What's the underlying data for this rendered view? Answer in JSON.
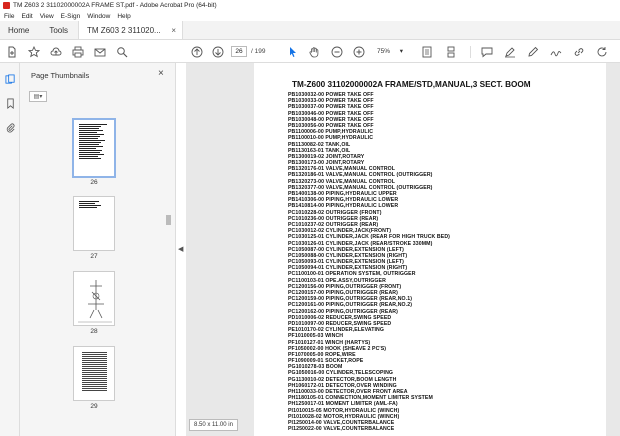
{
  "window": {
    "title": "TM Z603 2 31102000002A FRAME ST.pdf - Adobe Acrobat Pro (64-bit)"
  },
  "menu": [
    "File",
    "Edit",
    "View",
    "E-Sign",
    "Window",
    "Help"
  ],
  "tabs": {
    "home": "Home",
    "tools": "Tools",
    "document": "TM Z603 2 311020...",
    "close": "×"
  },
  "toolbar": {
    "current_page": "26",
    "total_pages": "/ 199",
    "zoom": "75%"
  },
  "thumbnails_panel": {
    "title": "Page Thumbnails",
    "close": "×",
    "options_icon": "▤▾",
    "pages": [
      "26",
      "27",
      "28",
      "29"
    ],
    "selected_page": "26"
  },
  "document": {
    "title": "TM-Z600 31102000002A FRAME/STD,MANUAL,3 SECT. BOOM",
    "entries": [
      "PB1030032-00 POWER TAKE OFF",
      "PB1030033-00 POWER TAKE OFF",
      "PB1030037-00 POWER TAKE OFF",
      "PB1030046-00 POWER TAKE OFF",
      "PB1030048-00 POWER TAKE OFF",
      "PB1030056-00 POWER TAKE OFF",
      "PB1100006-00 PUMP,HYDRAULIC",
      "PB1100010-00 PUMP,HYDRAULIC",
      "PB1130082-02 TANK,OIL",
      "PB1130163-01 TANK,OIL",
      "PB1300019-02 JOINT,ROTARY",
      "PB1300173-00 JOINT,ROTARY",
      "PB1320176-01 VALVE,MANUAL CONTROL",
      "PB1320186-01 VALVE,MANUAL CONTROL (OUTRIGGER)",
      "PB1320273-00 VALVE,MANUAL CONTROL",
      "PB1320377-00 VALVE,MANUAL CONTROL (OUTRIGGER)",
      "PB1400138-00 PIPING,HYDRAULIC UPPER",
      "PB1410306-00 PIPING,HYDRAULIC LOWER",
      "PB1410814-00 PIPING,HYDRAULIC LOWER",
      "PC1010228-02 OUTRIGGER (FRONT)",
      "PC1010236-00 OUTRIGGER (REAR)",
      "PC1010237-02 OUTRIGGER (REAR)",
      "PC1030012-02 CYLINDER,JACK(FRONT)",
      "PC1030125-01 CYLINDER,JACK (REAR FOR HIGH TRUCK BED)",
      "PC1030126-01 CYLINDER,JACK (REAR/STROKE 330MM)",
      "PC1050087-00 CYLINDER,EXTENSION (LEFT)",
      "PC1050088-00 CYLINDER,EXTENSION (RIGHT)",
      "PC1050093-01 CYLINDER,EXTENSION (LEFT)",
      "PC1050094-01 CYLINDER,EXTENSION (RIGHT)",
      "PC1100100-01 OPERATION SYSTEM, OUTRIGGER",
      "PC1100103-01 OPE.ASSY,OUTRIGGER",
      "PC1200156-00 PIPING,OUTRIGGER (FRONT)",
      "PC1200157-00 PIPING,OUTRIGGER (REAR)",
      "PC1200159-00 PIPING,OUTRIGGER (REAR,NO.1)",
      "PC1200161-00 PIPING,OUTRIGGER (REAR,NO.2)",
      "PC1200162-00 PIPING,OUTRIGGER (REAR)",
      "PD1010006-02 REDUCER,SWING SPEED",
      "PD1010097-00 REDUCER,SWING SPEED",
      "PE1010170-02 CYLINDER,ELEVATING",
      "PF1010005-03 WINCH",
      "PF1010127-01 WINCH (HARTYS)",
      "PF1050002-00 HOOK (SHEAVE 2 PC'S)",
      "PF1070005-00 ROPE,WIRE",
      "PF1090009-01 SOCKET,ROPE",
      "PG1010278-03 BOOM",
      "PG1050016-00 CYLINDER,TELESCOPING",
      "PG1130010-02 DETECTOR,BOOM LENGTH",
      "PH1060172-01 DETECTOR,OVER WINDING",
      "PH1100033-00 DETECTOR,OVER FRONT AREA",
      "PH1180105-01 CONNECTION,MOMENT LIMITER SYSTEM",
      "PH1250017-01 MOMENT LIMITER (AML-FA)",
      "PI1010015-05 MOTOR,HYDRAULIC (WINCH)",
      "PI1010028-02 MOTOR,HYDRAULIC (WINCH)",
      "PI1250014-00 VALVE,COUNTERBALANCE",
      "PI1250022-00 VALVE,COUNTERBALANCE"
    ]
  },
  "status": {
    "page_size": "8.50 x 11.00 in"
  },
  "colors": {
    "accent": "#1473e6",
    "acrobat_red": "#d7261e",
    "selection_border": "#8fb4e8"
  }
}
